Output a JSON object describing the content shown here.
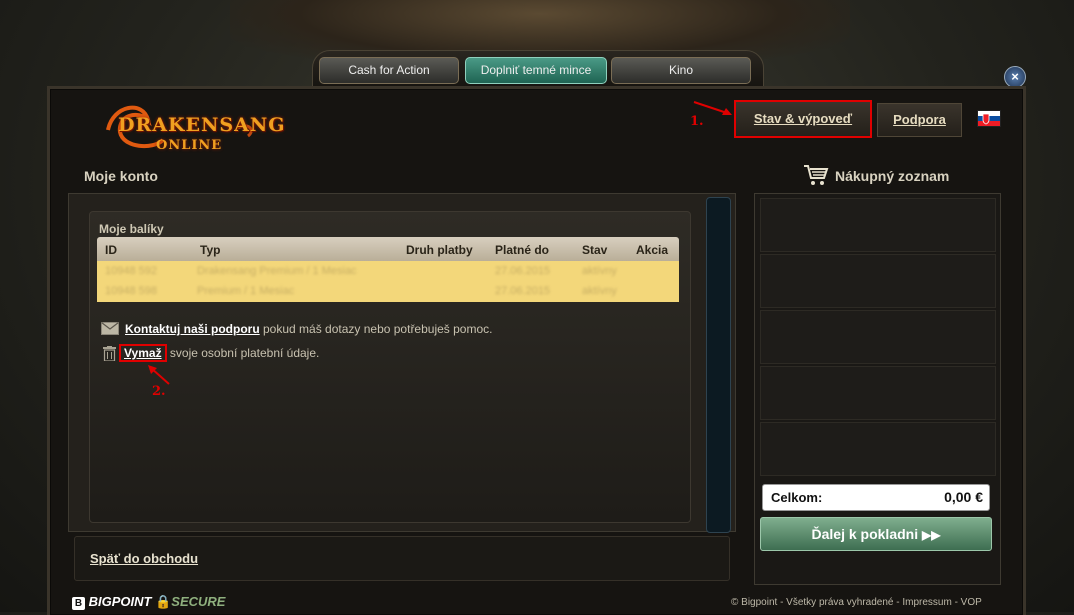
{
  "tabs": [
    {
      "label": "Cash for Action",
      "active": false
    },
    {
      "label": "Doplniť temné mince",
      "active": true
    },
    {
      "label": "Kino",
      "active": false
    }
  ],
  "close_label": "×",
  "logo": {
    "line1": "DRAKENSANG",
    "line2": "ONLINE"
  },
  "header": {
    "status_button": "Stav & výpoveď",
    "support_button": "Podpora",
    "annotation1": "1.",
    "flag_country": "Slovakia"
  },
  "account": {
    "title": "Moje konto",
    "packages_title": "Moje balíky",
    "columns": [
      "ID",
      "Typ",
      "Druh platby",
      "Platné do",
      "Stav",
      "Akcia"
    ],
    "rows": [
      [
        "10948 592",
        "Drakensang Premium / 1 Mesiac",
        "",
        "27.06.2015",
        "aktívny",
        ""
      ],
      [
        "10948 598",
        "Premium / 1 Mesiac",
        "",
        "27.06.2015",
        "aktívny",
        ""
      ]
    ],
    "contact_link": "Kontaktuj naši podporu",
    "contact_rest": " pokud máš dotazy nebo potřebuješ pomoc.",
    "delete_link": "Vymaž",
    "delete_rest": " svoje osobní platební údaje.",
    "annotation2": "2.",
    "back_link": "Späť do obchodu"
  },
  "cart": {
    "title": "Nákupný zoznam",
    "total_label": "Celkom:",
    "total_value": "0,00 €",
    "checkout_button": "Ďalej k pokladni"
  },
  "footer": {
    "brand": "BIGPOINT",
    "secure": "SECURE",
    "copyright": "© Bigpoint - Všetky práva vyhradené - Impressum - VOP"
  },
  "colors": {
    "accent_red": "#e00000",
    "active_tab": "#2f7d69",
    "row_highlight": "#f3d77a"
  }
}
